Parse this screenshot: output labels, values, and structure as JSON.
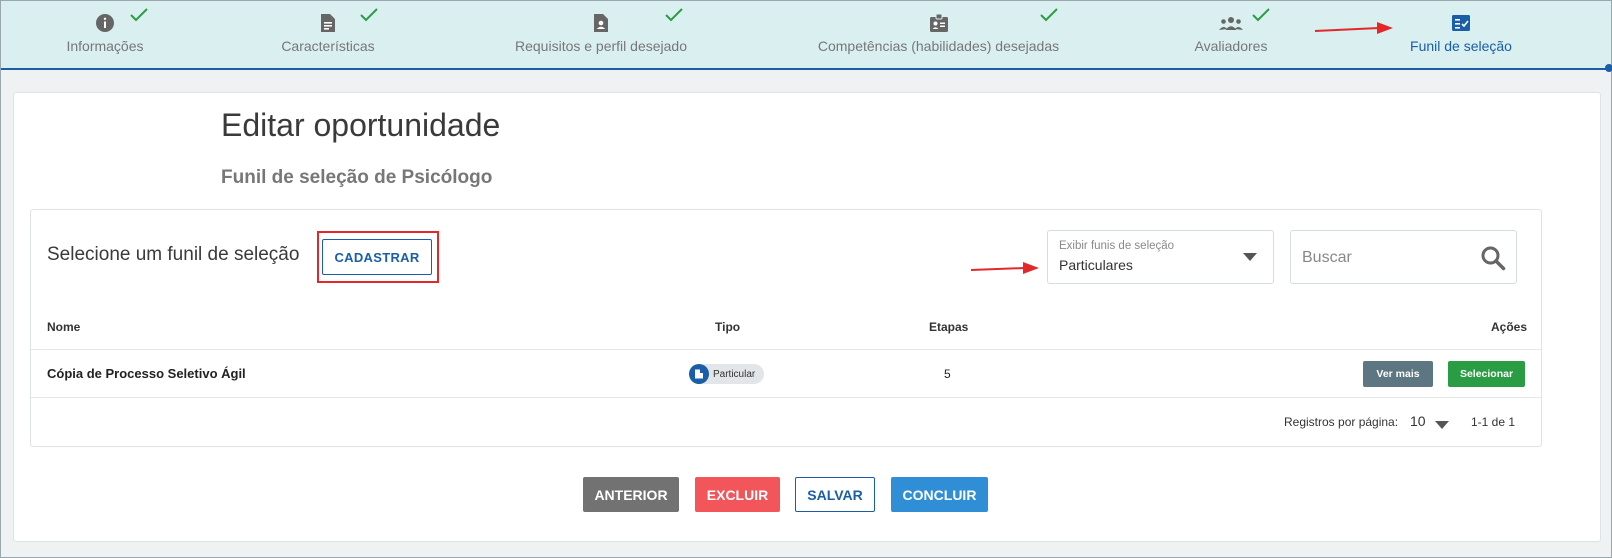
{
  "stepper": {
    "steps": [
      {
        "label": "Informações",
        "icon": "info-icon",
        "done": true
      },
      {
        "label": "Características",
        "icon": "document-icon",
        "done": true
      },
      {
        "label": "Requisitos e perfil desejado",
        "icon": "profile-doc-icon",
        "done": true
      },
      {
        "label": "Competências (habilidades) desejadas",
        "icon": "id-badge-icon",
        "done": true
      },
      {
        "label": "Avaliadores",
        "icon": "group-icon",
        "done": true
      },
      {
        "label": "Funil de seleção",
        "icon": "checklist-icon",
        "done": false,
        "active": true
      }
    ],
    "active_color": "#1a5ea8",
    "check_color": "#2a9d44"
  },
  "page": {
    "title": "Editar oportunidade",
    "subtitle": "Funil de seleção de Psicólogo"
  },
  "panel": {
    "title": "Selecione um funil de seleção",
    "cadastrar_label": "CADASTRAR",
    "filter": {
      "label": "Exibir funis de seleção",
      "value": "Particulares"
    },
    "search": {
      "placeholder": "Buscar"
    }
  },
  "table": {
    "headers": {
      "nome": "Nome",
      "tipo": "Tipo",
      "etapas": "Etapas",
      "acoes": "Ações"
    },
    "rows": [
      {
        "nome": "Cópia de Processo Seletivo Ágil",
        "tipo": "Particular",
        "etapas": "5",
        "ver_mais": "Ver mais",
        "selecionar": "Selecionar"
      }
    ]
  },
  "pagination": {
    "label": "Registros por página:",
    "per_page": "10",
    "range": "1-1 de 1"
  },
  "footer": {
    "anterior": "ANTERIOR",
    "excluir": "EXCLUIR",
    "salvar": "SALVAR",
    "concluir": "CONCLUIR"
  },
  "annotation_color": "#e4282a"
}
